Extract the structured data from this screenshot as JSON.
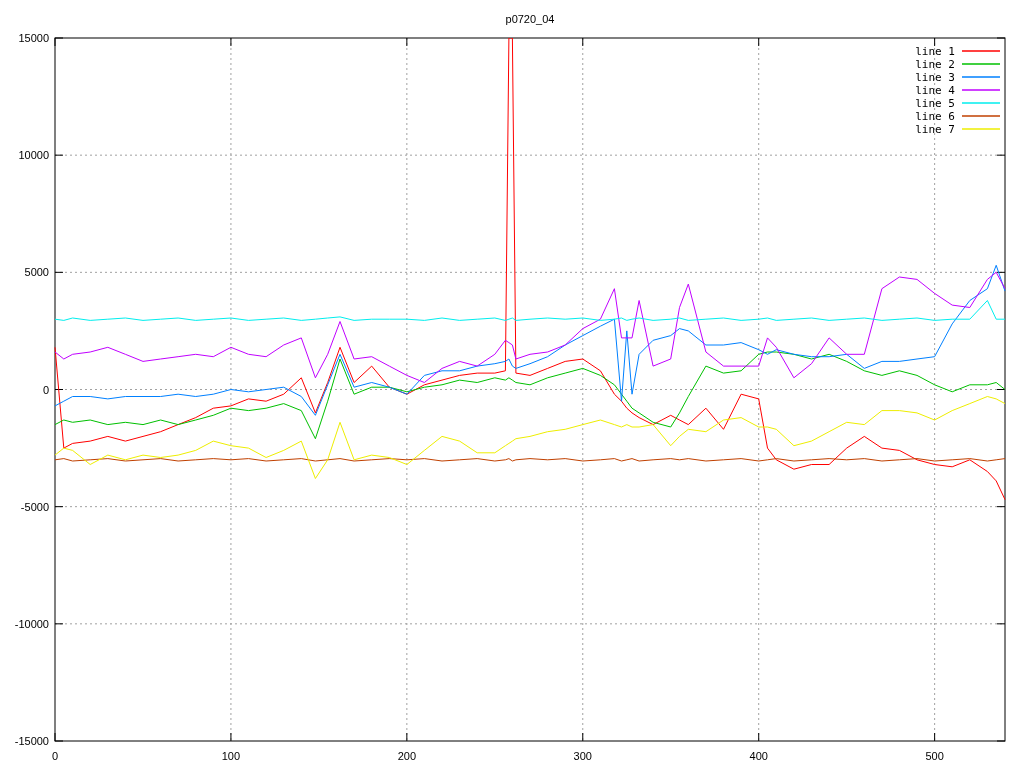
{
  "chart_data": {
    "type": "line",
    "title": "p0720_04",
    "grid": true,
    "legend": true,
    "xlim": [
      0,
      540
    ],
    "ylim": [
      -15000,
      15000
    ],
    "xticks": [
      0,
      100,
      200,
      300,
      400,
      500
    ],
    "yticks": [
      -15000,
      -10000,
      -5000,
      0,
      5000,
      10000,
      15000
    ],
    "x": [
      0,
      5,
      10,
      20,
      30,
      40,
      50,
      60,
      70,
      80,
      90,
      100,
      110,
      120,
      130,
      140,
      148,
      155,
      162,
      170,
      180,
      190,
      200,
      210,
      220,
      230,
      240,
      250,
      256,
      258,
      260,
      262,
      270,
      280,
      290,
      300,
      310,
      318,
      322,
      325,
      328,
      332,
      340,
      350,
      355,
      360,
      370,
      380,
      390,
      400,
      405,
      410,
      420,
      430,
      440,
      450,
      460,
      470,
      480,
      490,
      500,
      510,
      520,
      530,
      535,
      540
    ],
    "series": [
      {
        "name": "line 1",
        "color": "#ff0000",
        "values": [
          1800,
          -2500,
          -2300,
          -2200,
          -2000,
          -2200,
          -2000,
          -1800,
          -1500,
          -1200,
          -800,
          -700,
          -400,
          -500,
          -200,
          500,
          -1000,
          300,
          1800,
          300,
          1000,
          100,
          -200,
          200,
          400,
          600,
          700,
          700,
          800,
          15000,
          15000,
          700,
          600,
          900,
          1200,
          1300,
          800,
          -200,
          -500,
          -800,
          -1000,
          -1200,
          -1500,
          -1100,
          -1300,
          -1500,
          -800,
          -1700,
          -200,
          -400,
          -2500,
          -3000,
          -3400,
          -3200,
          -3200,
          -2500,
          -2000,
          -2500,
          -2600,
          -3000,
          -3200,
          -3300,
          -3000,
          -3500,
          -3900,
          -4700
        ]
      },
      {
        "name": "line 2",
        "color": "#00c000",
        "values": [
          -1500,
          -1300,
          -1400,
          -1300,
          -1500,
          -1400,
          -1500,
          -1300,
          -1500,
          -1300,
          -1100,
          -800,
          -900,
          -800,
          -600,
          -900,
          -2100,
          -500,
          1300,
          -200,
          100,
          100,
          -100,
          100,
          200,
          400,
          300,
          500,
          400,
          500,
          400,
          300,
          200,
          500,
          700,
          900,
          600,
          200,
          -200,
          -500,
          -800,
          -1000,
          -1400,
          -1600,
          -1000,
          -300,
          1000,
          700,
          800,
          1500,
          1600,
          1600,
          1500,
          1300,
          1500,
          1200,
          800,
          600,
          800,
          600,
          200,
          -100,
          200,
          200,
          300,
          0
        ]
      },
      {
        "name": "line 3",
        "color": "#0080ff",
        "values": [
          -700,
          -500,
          -300,
          -300,
          -400,
          -300,
          -300,
          -300,
          -200,
          -300,
          -200,
          0,
          -100,
          0,
          100,
          -300,
          -1100,
          200,
          1500,
          100,
          300,
          100,
          -200,
          600,
          800,
          800,
          1000,
          1100,
          1200,
          1300,
          1000,
          900,
          1100,
          1400,
          1900,
          2300,
          2700,
          3000,
          -500,
          2500,
          -200,
          1500,
          2100,
          2300,
          2600,
          2500,
          1900,
          1900,
          2000,
          1700,
          1500,
          1700,
          1500,
          1400,
          1400,
          1500,
          900,
          1200,
          1200,
          1300,
          1400,
          2800,
          3800,
          4300,
          5300,
          4200
        ]
      },
      {
        "name": "line 4",
        "color": "#c000ff",
        "values": [
          1600,
          1300,
          1500,
          1600,
          1800,
          1500,
          1200,
          1300,
          1400,
          1500,
          1400,
          1800,
          1500,
          1400,
          1900,
          2200,
          500,
          1500,
          2900,
          1300,
          1400,
          1000,
          600,
          300,
          900,
          1200,
          1000,
          1500,
          2100,
          2000,
          1900,
          1300,
          1500,
          1600,
          1900,
          2600,
          3000,
          4300,
          2200,
          2200,
          2200,
          3800,
          1000,
          1300,
          3500,
          4500,
          1600,
          1000,
          1000,
          1000,
          2200,
          1800,
          500,
          1100,
          2200,
          1500,
          1500,
          4300,
          4800,
          4700,
          4100,
          3600,
          3500,
          4700,
          5000,
          4300
        ]
      },
      {
        "name": "line 5",
        "color": "#00eeee",
        "values": [
          3000,
          2950,
          3050,
          2950,
          3000,
          3050,
          2950,
          3000,
          3050,
          2950,
          3000,
          3050,
          2950,
          3000,
          3050,
          2950,
          3000,
          3050,
          3100,
          2950,
          3000,
          3000,
          3000,
          2950,
          3050,
          2950,
          3000,
          3050,
          2950,
          3000,
          3050,
          2950,
          3000,
          3050,
          3000,
          3050,
          2950,
          3000,
          3050,
          2950,
          3000,
          3050,
          2950,
          3000,
          3050,
          2950,
          3000,
          3050,
          2950,
          3000,
          3050,
          2950,
          3000,
          3050,
          2950,
          3000,
          3050,
          2950,
          3000,
          3050,
          2950,
          3000,
          3000,
          3800,
          3000,
          3000
        ]
      },
      {
        "name": "line 6",
        "color": "#c04000",
        "values": [
          -3000,
          -2950,
          -3050,
          -3000,
          -2950,
          -3050,
          -3000,
          -2950,
          -3050,
          -3000,
          -2950,
          -3000,
          -2950,
          -3050,
          -3000,
          -2950,
          -3050,
          -3000,
          -2950,
          -3050,
          -3000,
          -2950,
          -3000,
          -2950,
          -3050,
          -3000,
          -2950,
          -3050,
          -3000,
          -2950,
          -3050,
          -3000,
          -2950,
          -3000,
          -2950,
          -3050,
          -3000,
          -2950,
          -3050,
          -3000,
          -2950,
          -3050,
          -3000,
          -2950,
          -3000,
          -2950,
          -3050,
          -3000,
          -2950,
          -3050,
          -3000,
          -2950,
          -3050,
          -3000,
          -2950,
          -3000,
          -2950,
          -3050,
          -3000,
          -2950,
          -3050,
          -3000,
          -2950,
          -3050,
          -3000,
          -2950
        ]
      },
      {
        "name": "line 7",
        "color": "#eeee00",
        "values": [
          -2800,
          -2500,
          -2600,
          -3200,
          -2800,
          -3000,
          -2800,
          -2900,
          -2800,
          -2600,
          -2200,
          -2400,
          -2500,
          -2900,
          -2600,
          -2200,
          -3800,
          -3000,
          -1400,
          -3000,
          -2800,
          -2900,
          -3200,
          -2600,
          -2000,
          -2200,
          -2700,
          -2700,
          -2400,
          -2300,
          -2200,
          -2100,
          -2000,
          -1800,
          -1700,
          -1500,
          -1300,
          -1500,
          -1600,
          -1500,
          -1600,
          -1600,
          -1500,
          -2400,
          -2000,
          -1700,
          -1800,
          -1300,
          -1200,
          -1600,
          -1600,
          -1700,
          -2400,
          -2200,
          -1800,
          -1400,
          -1500,
          -900,
          -900,
          -1000,
          -1300,
          -900,
          -600,
          -300,
          -400,
          -600
        ]
      }
    ]
  }
}
